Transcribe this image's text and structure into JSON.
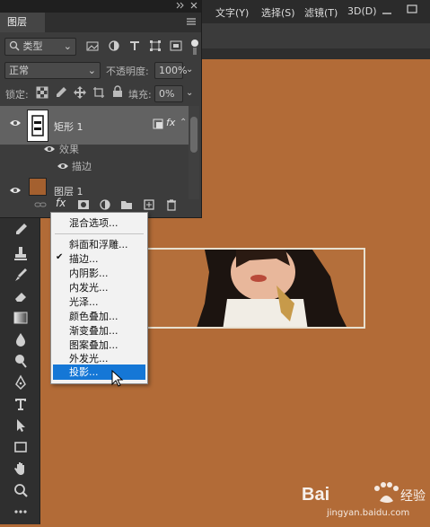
{
  "menubar": {
    "items": [
      "文字(Y)",
      "选择(S)",
      "滤镜(T)",
      "3D(D)"
    ]
  },
  "layers_panel": {
    "tab_label": "图层",
    "filter_kind": "类型",
    "blend_mode": "正常",
    "opacity_label": "不透明度:",
    "opacity_value": "100%",
    "lock_label": "锁定:",
    "fill_label": "填充:",
    "fill_value": "0%",
    "layers": [
      {
        "name": "矩形 1",
        "effects_label": "效果",
        "effect": "描边"
      },
      {
        "name": "图层 1"
      }
    ]
  },
  "context_menu": {
    "items": [
      "混合选项...",
      "斜面和浮雕...",
      "描边...",
      "内阴影...",
      "内发光...",
      "光泽...",
      "颜色叠加...",
      "渐变叠加...",
      "图案叠加...",
      "外发光...",
      "投影..."
    ],
    "checked_item": "描边...",
    "highlighted_item": "投影...",
    "check_mark": "✔"
  },
  "watermark": {
    "brand": "Bai",
    "brand_cn": "经验",
    "url": "jingyan.baidu.com"
  },
  "colors": {
    "canvas": "#b26b37",
    "panel": "#3c3c3c",
    "highlight": "#1577d6"
  }
}
